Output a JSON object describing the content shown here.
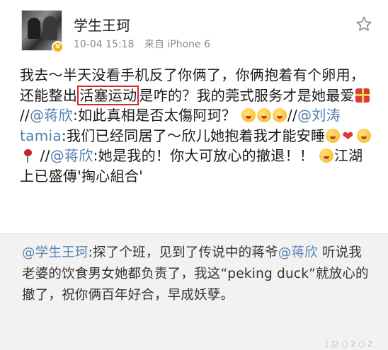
{
  "post": {
    "username": "学生王珂",
    "date": "10-04 15:18",
    "source": "来自 iPhone 6",
    "text": {
      "p1": "我去～半天没看手机反了你俩了，你俩抱着有个卵用，还能整出",
      "highlight": "活塞运动",
      "p2": "是咋的？我的莞式服务才是她最爱",
      "p3": "//",
      "mention1": "@蒋欣",
      "p4": ":如此真相是否太傷阿珂？",
      "p5": "//",
      "mention2": "@刘涛tamia",
      "p6": ":我们已经同居了～欣儿她抱着我才能安睡",
      "p7": " //",
      "mention3": "@蒋欣",
      "p8": ":她是我的！你大可放心的撤退！！",
      "p9": "江湖上已盛傳'掏心組合'"
    },
    "icons": {
      "star": "star-icon",
      "verified": "verified-badge-icon"
    }
  },
  "repost": {
    "mention_author": "@学生王珂",
    "t1": ":探了个班，见到了传说中的蒋爷",
    "mention_jiang": "@蒋欣",
    "t2": " 听说我老婆的饮食男女她都负责了，我这“peking duck”就放心的撤了，祝你俩百年好合，早成妖孽。",
    "stats": "[ ]2 ○ 2 ○ 2"
  },
  "colors": {
    "mention": "#507daf",
    "highlight_border": "#d32a2a",
    "meta": "#8a8a8a",
    "repost_bg": "#f2f2f2"
  }
}
